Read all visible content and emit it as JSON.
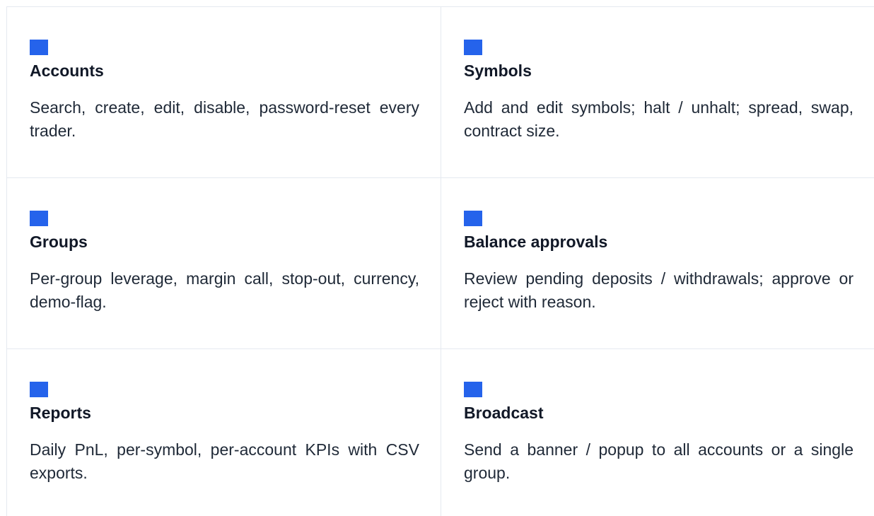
{
  "features": [
    {
      "title": "Accounts",
      "description": "Search, create, edit, disable, password-reset every trader.",
      "icon": "square-icon"
    },
    {
      "title": "Symbols",
      "description": "Add and edit symbols; halt / unhalt; spread, swap, contract size.",
      "icon": "square-icon"
    },
    {
      "title": "Groups",
      "description": "Per-group leverage, margin call, stop-out, currency, demo-flag.",
      "icon": "square-icon"
    },
    {
      "title": "Balance approvals",
      "description": "Review pending deposits / withdrawals; approve or reject with reason.",
      "icon": "square-icon"
    },
    {
      "title": "Reports",
      "description": "Daily PnL, per-symbol, per-account KPIs with CSV exports.",
      "icon": "square-icon"
    },
    {
      "title": "Broadcast",
      "description": "Send a banner / popup to all accounts or a single group.",
      "icon": "square-icon"
    }
  ],
  "colors": {
    "accent": "#2563eb",
    "border": "#e5e9f0",
    "title": "#111827",
    "text": "#1f2937"
  }
}
